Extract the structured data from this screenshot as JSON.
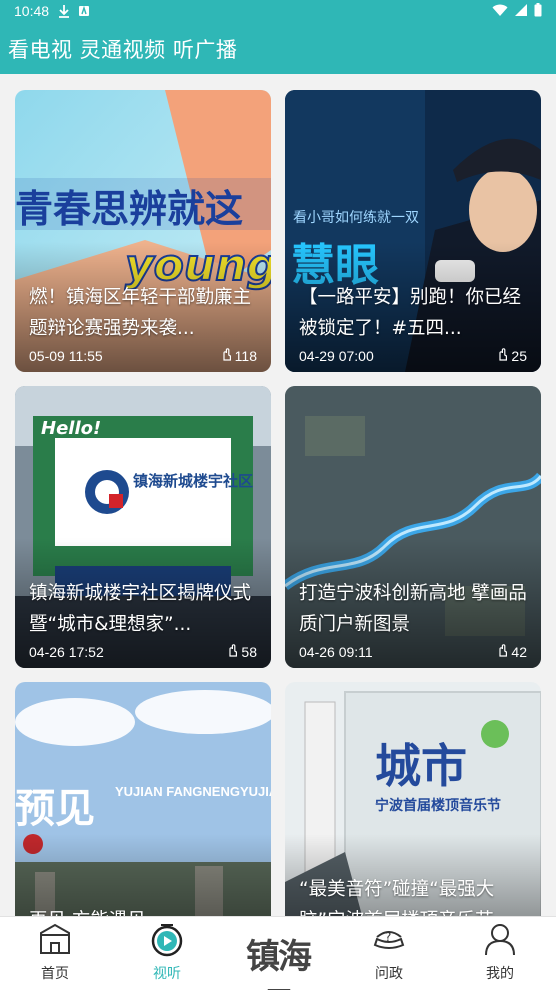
{
  "status": {
    "time": "10:48"
  },
  "app": {
    "title": "看电视 灵通视频 听广播"
  },
  "colors": {
    "accent": "#2fb7b6"
  },
  "cards": [
    {
      "title": "燃！镇海区年轻干部勤廉主题辩论赛强势来袭...",
      "date": "05-09 11:55",
      "views": "118",
      "thumb_text": "青春思辨就这",
      "thumb_text2": "young"
    },
    {
      "title": "【一路平安】别跑！你已经被锁定了！#五四...",
      "date": "04-29 07:00",
      "views": "25",
      "thumb_text": "看小哥如何练就一双",
      "thumb_text2": "慧眼"
    },
    {
      "title": "镇海新城楼宇社区揭牌仪式暨“城市&理想家”...",
      "date": "04-26 17:52",
      "views": "58",
      "thumb_text": "镇海新城楼宇社区",
      "thumb_text2": "Hello!"
    },
    {
      "title": "打造宁波科创新高地 擘画品质门户新图景",
      "date": "04-26 09:11",
      "views": "42",
      "thumb_text": "",
      "thumb_text2": ""
    },
    {
      "title": "再见 方能遇见",
      "date": "",
      "views": "",
      "thumb_text": "预见",
      "thumb_text2": "YUJIAN FANGNENGYUJIA"
    },
    {
      "title": "“最美音符”碰撞“最强大脑”宁波首届楼顶音乐节...",
      "date": "",
      "views": "",
      "thumb_text": "城市",
      "thumb_text2": "宁波首届楼顶音乐节"
    }
  ],
  "tabs": [
    {
      "label": "首页",
      "icon": "home-icon"
    },
    {
      "label": "视听",
      "icon": "play-icon"
    },
    {
      "label": "镇海号",
      "icon": "zhenhai-logo"
    },
    {
      "label": "问政",
      "icon": "question-icon"
    },
    {
      "label": "我的",
      "icon": "user-icon"
    }
  ]
}
